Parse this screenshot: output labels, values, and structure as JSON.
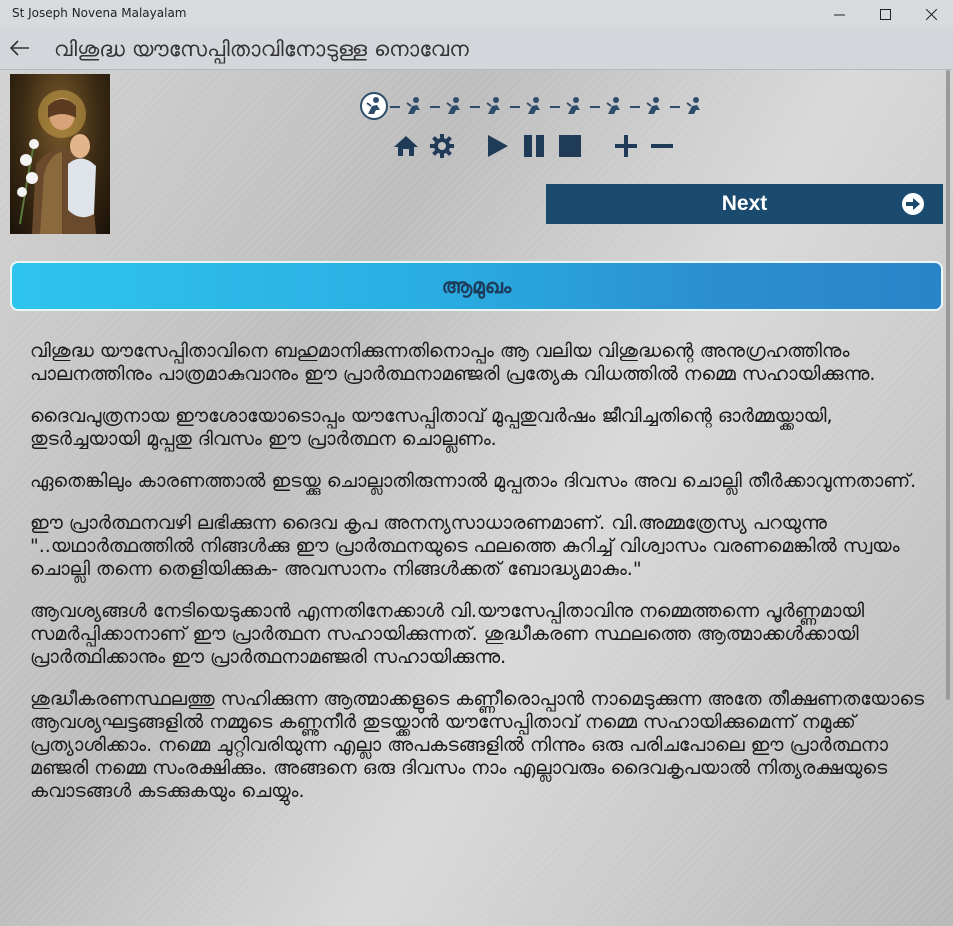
{
  "window": {
    "title": "St Joseph Novena Malayalam"
  },
  "header": {
    "title": "വിശുദ്ധ യൗസേപ്പിതാവിനോടുള്ള നൊവേന"
  },
  "icons": {
    "back": "back-arrow-icon",
    "step": "praying-figure-icon",
    "home": "home-icon",
    "settings": "gear-icon",
    "play": "play-icon",
    "pause": "pause-icon",
    "stop": "stop-icon",
    "zoom_in": "plus-icon",
    "zoom_out": "minus-icon",
    "next": "arrow-circle-right-icon"
  },
  "progress": {
    "total_steps": 9,
    "current_step": 1
  },
  "next_button": {
    "label": "Next"
  },
  "section": {
    "title": "ആമുഖം"
  },
  "paragraphs": [
    "വിശുദ്ധ യൗസേപ്പിതാവിനെ ബഹുമാനിക്കുന്നതിനൊപ്പം ആ വലിയ വിശുദ്ധന്റെ അനുഗ്രഹത്തിനും പാലനത്തിനും പാത്രമാകുവാനും ഈ പ്രാർത്ഥനാമഞ്ജരി പ്രത്യേക വിധത്തിൽ നമ്മെ സഹായിക്കുന്നു.",
    "ദൈവപുത്രനായ ഈശോയോടൊപ്പം യൗസേപ്പിതാവ് മുപ്പതുവർഷം ജീവിച്ചതിന്റെ ഓർമ്മയ്ക്കായി, തുടർച്ചയായി മുപ്പതു ദിവസം ഈ പ്രാർത്ഥന ചൊല്ലണം.",
    "ഏതെങ്കിലും കാരണത്താൽ ഇടയ്ക്കു ചൊല്ലാതിരുന്നാൽ മുപ്പതാം ദിവസം അവ ചൊല്ലി തീർക്കാവുന്നതാണ്.",
    "ഈ പ്രാർത്ഥനവഴി ലഭിക്കുന്ന ദൈവ കൃപ അനന്യസാധാരണമാണ്. വി.അമ്മത്രേസ്യ പറയുന്നു \"..യഥാർത്ഥത്തിൽ നിങ്ങൾക്കു ഈ പ്രാർത്ഥനയുടെ ഫലത്തെ കുറിച്ച് വിശ്വാസം വരണമെങ്കിൽ സ്വയം ചൊല്ലി തന്നെ തെളിയിക്കുക- അവസാനം നിങ്ങൾക്കത് ബോദ്ധ്യമാകും.\"",
    "ആവശ്യങ്ങൾ നേടിയെടുക്കാൻ എന്നതിനേക്കാൾ വി.യൗസേപ്പിതാവിനു നമ്മെത്തന്നെ പൂർണ്ണമായി സമർപ്പിക്കാനാണ് ഈ പ്രാർത്ഥന സഹായിക്കുന്നത്. ശുദ്ധീകരണ സ്ഥലത്തെ ആത്മാക്കൾക്കായി പ്രാർത്ഥിക്കാനും ഈ പ്രാർത്ഥനാമഞ്ജരി സഹായിക്കുന്നു.",
    "ശുദ്ധീകരണസ്ഥലത്തു സഹിക്കുന്ന ആത്മാക്കളുടെ കണ്ണീരൊപ്പാൻ നാമെടുക്കുന്ന അതേ തീക്ഷണതയോടെ ആവശ്യഘട്ടങ്ങളിൽ നമ്മുടെ കണ്ണുനീർ തുടയ്ക്കാൻ യൗസേപ്പിതാവ് നമ്മെ സഹായിക്കുമെന്ന് നമുക്ക് പ്രത്യാശിക്കാം. നമ്മെ ചുറ്റിവരിയുന്ന എല്ലാ അപകടങ്ങളിൽ നിന്നും ഒരു പരിചപോലെ ഈ പ്രാർത്ഥനാ മഞ്ജരി നമ്മെ സംരക്ഷിക്കും. അങ്ങനെ ഒരു ദിവസം നാം എല്ലാവരും ദൈവകൃപയാൽ നിത്യരക്ഷയുടെ കവാടങ്ങൾ കടക്കുകയും ചെയ്യും."
  ]
}
